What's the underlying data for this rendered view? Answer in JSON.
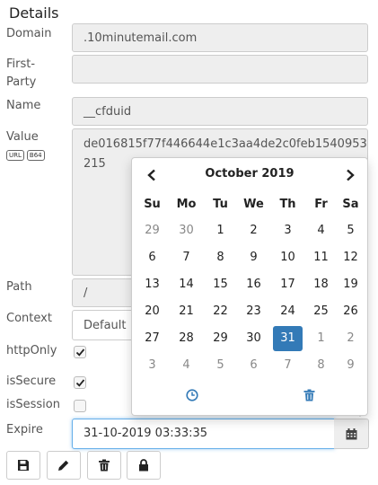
{
  "heading": "Details",
  "labels": {
    "domain": "Domain",
    "first_party_1": "First-",
    "first_party_2": "Party",
    "name": "Name",
    "value": "Value",
    "path": "Path",
    "context": "Context",
    "http_only": "httpOnly",
    "is_secure": "isSecure",
    "is_session": "isSession",
    "expire": "Expire"
  },
  "badges": {
    "url": "URL",
    "b64": "B64"
  },
  "fields": {
    "domain": ".10minutemail.com",
    "first_party": "",
    "name": "__cfduid",
    "value_line1": "de016815f77f446644e1c3aa4de2c0feb1540953",
    "value_line2": "215",
    "path": "/",
    "context": "Default",
    "expire": "31-10-2019 03:33:35"
  },
  "checks": {
    "http_only": true,
    "is_secure": true,
    "is_session": false
  },
  "calendar": {
    "month_label": "October 2019",
    "weekdays": [
      "Su",
      "Mo",
      "Tu",
      "We",
      "Th",
      "Fr",
      "Sa"
    ],
    "weeks": [
      [
        {
          "d": "29",
          "m": true
        },
        {
          "d": "30",
          "m": true
        },
        {
          "d": "1"
        },
        {
          "d": "2"
        },
        {
          "d": "3"
        },
        {
          "d": "4"
        },
        {
          "d": "5"
        }
      ],
      [
        {
          "d": "6"
        },
        {
          "d": "7"
        },
        {
          "d": "8"
        },
        {
          "d": "9"
        },
        {
          "d": "10"
        },
        {
          "d": "11"
        },
        {
          "d": "12"
        }
      ],
      [
        {
          "d": "13"
        },
        {
          "d": "14"
        },
        {
          "d": "15"
        },
        {
          "d": "16"
        },
        {
          "d": "17"
        },
        {
          "d": "18"
        },
        {
          "d": "19"
        }
      ],
      [
        {
          "d": "20"
        },
        {
          "d": "21"
        },
        {
          "d": "22"
        },
        {
          "d": "23"
        },
        {
          "d": "24"
        },
        {
          "d": "25"
        },
        {
          "d": "26"
        }
      ],
      [
        {
          "d": "27"
        },
        {
          "d": "28"
        },
        {
          "d": "29"
        },
        {
          "d": "30"
        },
        {
          "d": "31",
          "sel": true
        },
        {
          "d": "1",
          "m": true
        },
        {
          "d": "2",
          "m": true
        }
      ],
      [
        {
          "d": "3",
          "m": true
        },
        {
          "d": "4",
          "m": true
        },
        {
          "d": "5",
          "m": true
        },
        {
          "d": "6",
          "m": true
        },
        {
          "d": "7",
          "m": true
        },
        {
          "d": "8",
          "m": true
        },
        {
          "d": "9",
          "m": true
        }
      ]
    ],
    "accent": "#337ab7"
  },
  "icons": {
    "prev": "chevron-left-icon",
    "next": "chevron-right-icon",
    "time": "clock-icon",
    "clear": "trash-icon",
    "calendar": "calendar-icon",
    "save": "save-icon",
    "edit": "pencil-icon",
    "delete": "trash-icon",
    "lock": "lock-icon"
  }
}
